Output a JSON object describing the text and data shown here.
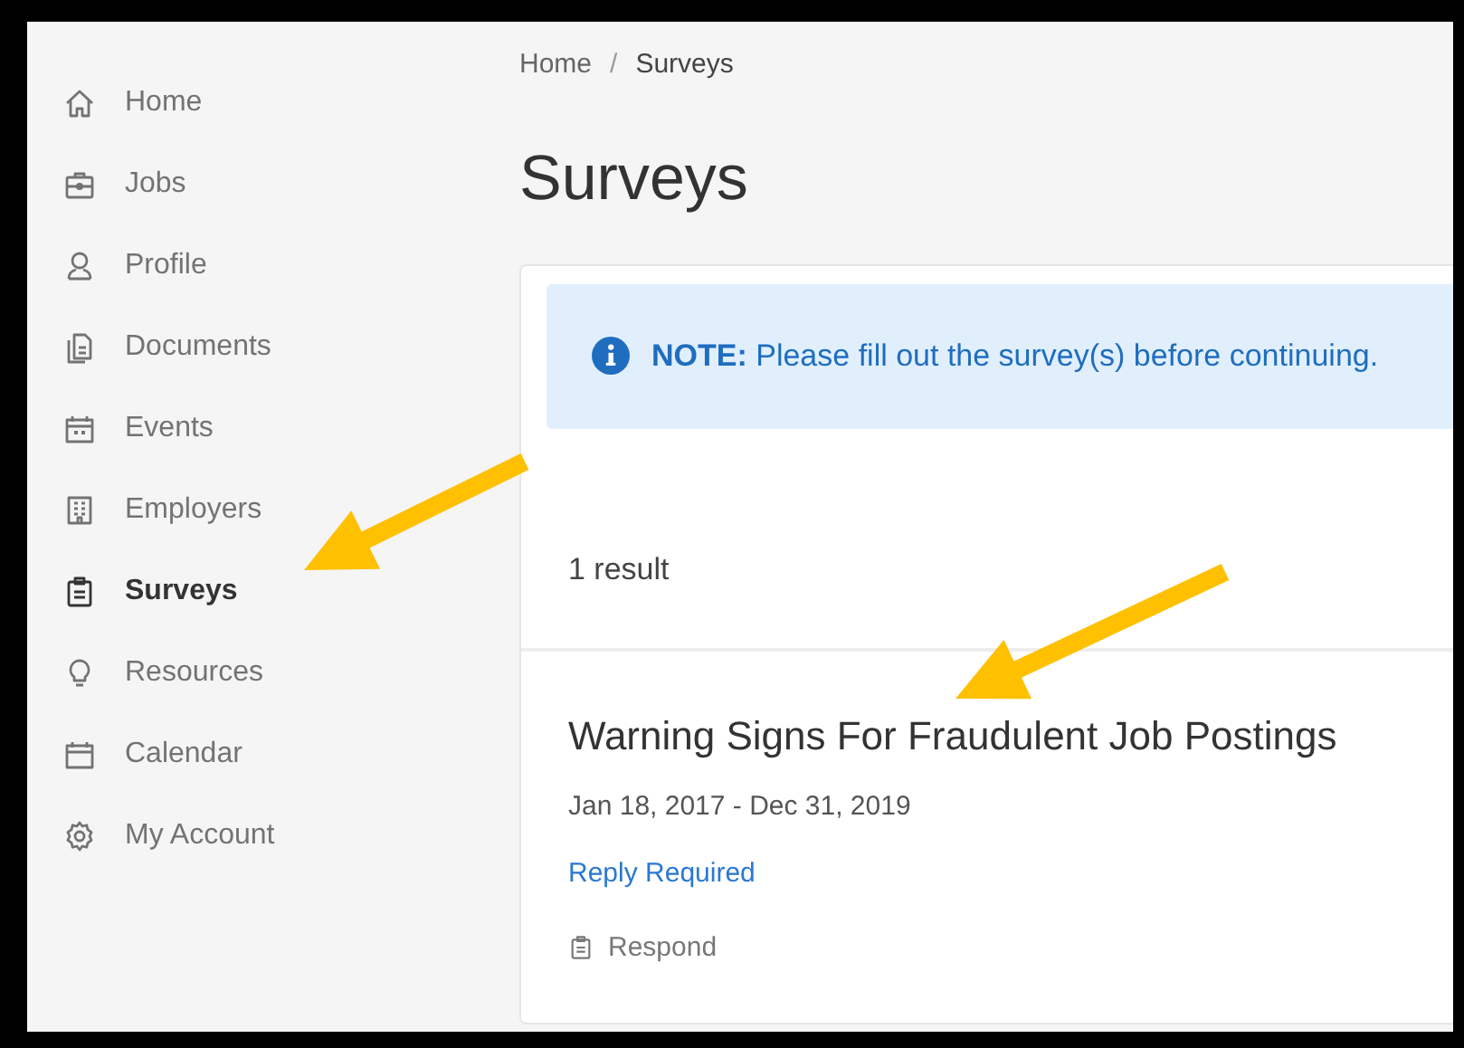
{
  "sidebar": {
    "items": [
      {
        "label": "Home",
        "selected": false
      },
      {
        "label": "Jobs",
        "selected": false
      },
      {
        "label": "Profile",
        "selected": false
      },
      {
        "label": "Documents",
        "selected": false
      },
      {
        "label": "Events",
        "selected": false
      },
      {
        "label": "Employers",
        "selected": false
      },
      {
        "label": "Surveys",
        "selected": true
      },
      {
        "label": "Resources",
        "selected": false
      },
      {
        "label": "Calendar",
        "selected": false
      },
      {
        "label": "My Account",
        "selected": false
      }
    ]
  },
  "breadcrumb": [
    {
      "label": "Home"
    },
    {
      "label": "Surveys"
    }
  ],
  "breadcrumb_separator": "/",
  "page_title": "Surveys",
  "alert": {
    "text": "**NOTE:** Please fill out the survey(s) before continuing."
  },
  "result_count": "1 result",
  "surveys": [
    {
      "title": "Warning Signs For Fraudulent Job Postings",
      "dates": "Jan 18, 2017 - Dec 31, 2019",
      "status": "Reply Required",
      "action": "Respond"
    }
  ]
}
